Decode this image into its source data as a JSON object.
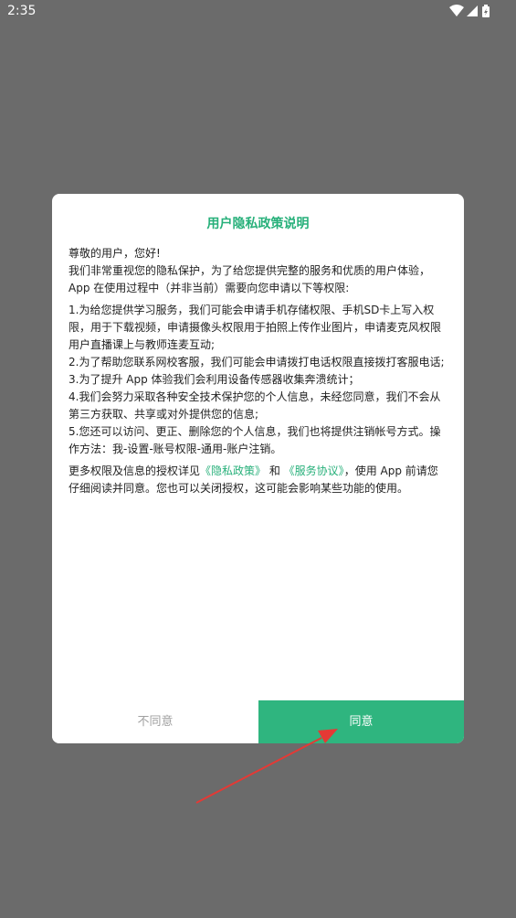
{
  "status_bar": {
    "time": "2:35",
    "icons": [
      "wifi-icon",
      "signal-icon",
      "battery-icon"
    ]
  },
  "dialog": {
    "title": "用户隐私政策说明",
    "greeting": "尊敬的用户，您好!",
    "intro": "我们非常重视您的隐私保护，为了给您提供完整的服务和优质的用户体验，App 在使用过程中（并非当前）需要向您申请以下等权限:",
    "items": [
      "1.为给您提供学习服务，我们可能会申请手机存储权限、手机SD卡上写入权限，用于下载视频，申请摄像头权限用于拍照上传作业图片，申请麦克风权限用户直播课上与教师连麦互动;",
      "2.为了帮助您联系网校客服，我们可能会申请拨打电话权限直接拨打客服电话;",
      "3.为了提升 App 体验我们会利用设备传感器收集奔溃统计；",
      "4.我们会努力采取各种安全技术保护您的个人信息，未经您同意，我们不会从第三方获取、共享或对外提供您的信息;",
      "5.您还可以访问、更正、删除您的个人信息，我们也将提供注销帐号方式。操作方法：我-设置-账号权限-通用-账户注销。"
    ],
    "footer_prefix": "更多权限及信息的授权详见",
    "privacy_link": "《隐私政策》",
    "footer_and": " 和 ",
    "service_link": "《服务协议》",
    "footer_suffix": "，使用 App 前请您仔细阅读并同意。您也可以关闭授权，这可能会影响某些功能的使用。",
    "disagree_label": "不同意",
    "agree_label": "同意"
  },
  "colors": {
    "accent": "#2fb57f",
    "title": "#27b07a",
    "overlay": "#6b6b6b",
    "annotation_arrow": "#e53935"
  }
}
